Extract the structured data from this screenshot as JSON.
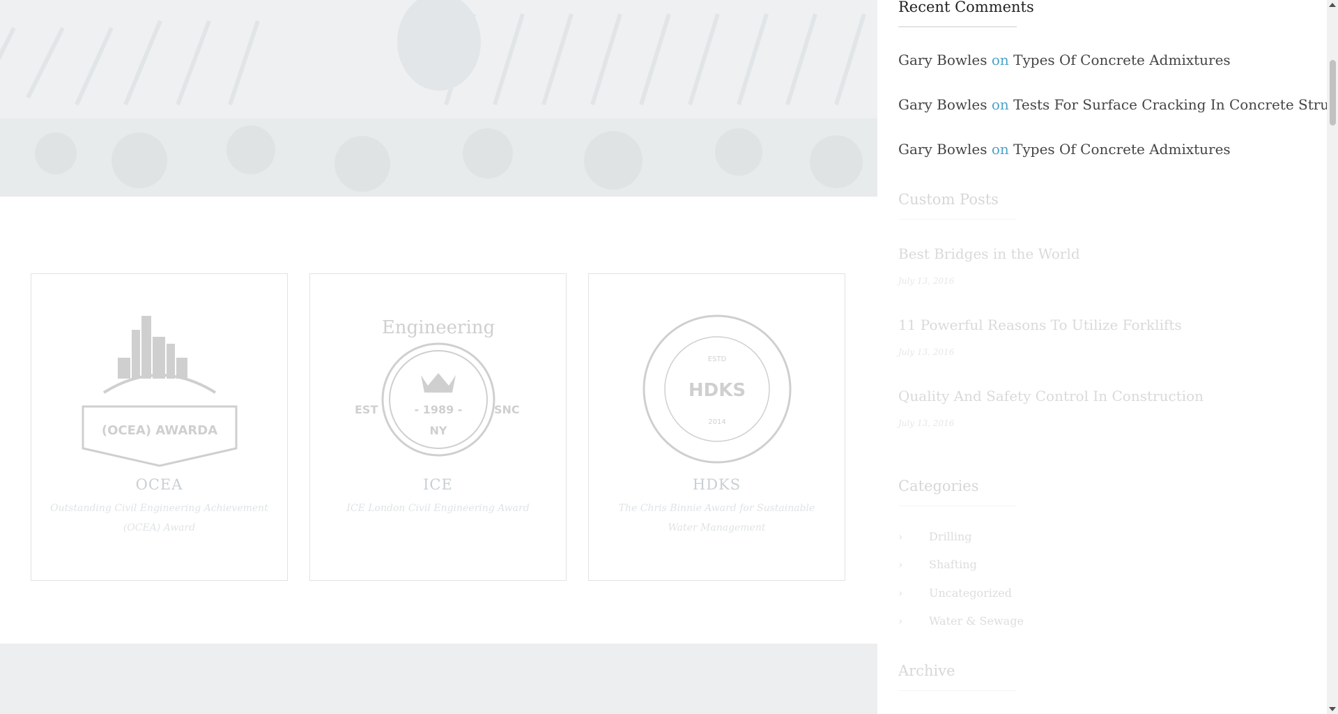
{
  "hero": {
    "image": "hero-photo-faded"
  },
  "awards": [
    {
      "name": "OCEA",
      "description": "Outstanding Civil Engineering Achievement (OCEA) Award",
      "logo_text": "(OCEA) AWARDA"
    },
    {
      "name": "ICE",
      "description": "ICE London Civil Engineering Award",
      "logo_text": "Engineering"
    },
    {
      "name": "HDKS",
      "description": "The Chris Binnie Award for Sustainable Water Management",
      "logo_text": "HDKS"
    }
  ],
  "sidebar": {
    "recent_comments": {
      "title": "Recent Comments",
      "items": [
        {
          "author": "Gary Bowles",
          "on": "on",
          "post": "Types Of Concrete Admixtures"
        },
        {
          "author": "Gary Bowles",
          "on": "on",
          "post": "Tests For Surface Cracking In Concrete Structures"
        },
        {
          "author": "Gary Bowles",
          "on": "on",
          "post": "Types Of Concrete Admixtures"
        }
      ]
    },
    "custom_posts": {
      "title": "Custom Posts",
      "items": [
        {
          "title": "Best Bridges in the World",
          "date": "July 13, 2016"
        },
        {
          "title": "11 Powerful Reasons To Utilize Forklifts",
          "date": "July 13, 2016"
        },
        {
          "title": "Quality And Safety Control In Construction",
          "date": "July 13, 2016"
        }
      ]
    },
    "categories": {
      "title": "Categories",
      "items": [
        "Drilling",
        "Shafting",
        "Uncategorized",
        "Water & Sewage"
      ]
    },
    "archive": {
      "title": "Archive"
    }
  },
  "colors": {
    "accent": "#4ca3c7",
    "card_border": "#dfe2e4",
    "band": "#eceef0"
  }
}
